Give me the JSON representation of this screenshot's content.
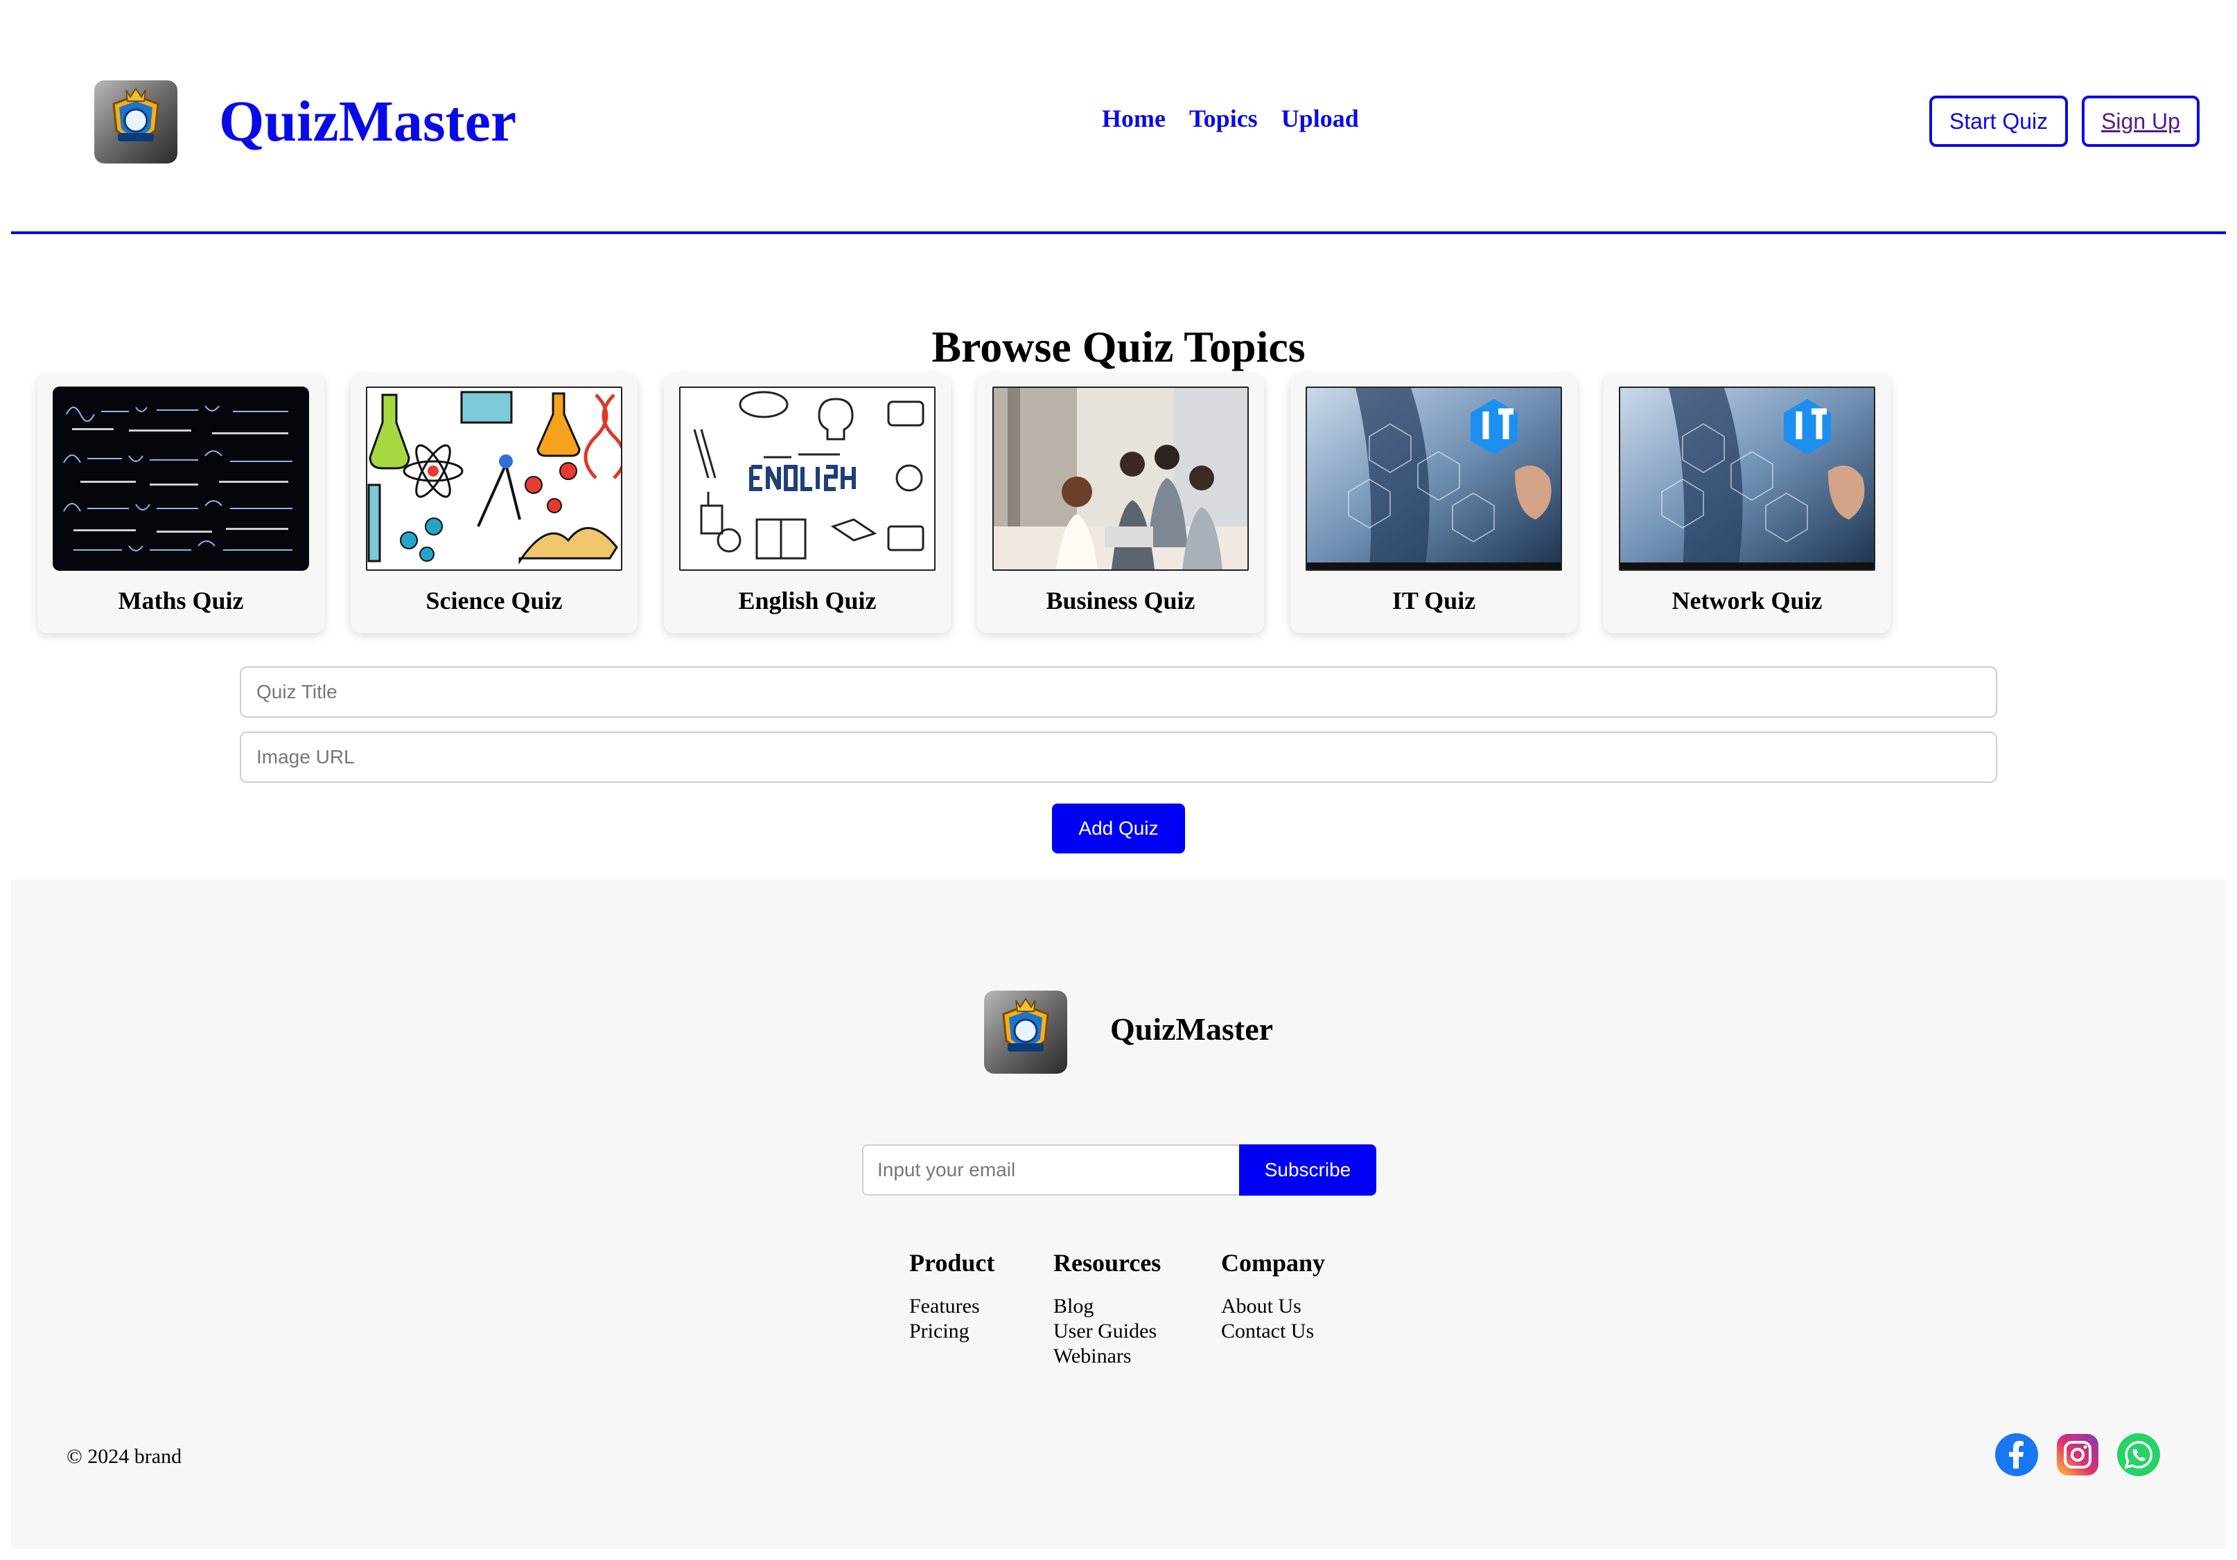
{
  "header": {
    "brand": "QuizMaster",
    "logo_icon": "quiz-master-logo",
    "nav": [
      {
        "label": "Home"
      },
      {
        "label": "Topics"
      },
      {
        "label": "Upload"
      }
    ],
    "start_quiz_label": "Start Quiz",
    "sign_up_label": "Sign Up"
  },
  "main": {
    "title": "Browse Quiz Topics",
    "topics": [
      {
        "label": "Maths Quiz"
      },
      {
        "label": "Science Quiz"
      },
      {
        "label": "English Quiz"
      },
      {
        "label": "Business Quiz"
      },
      {
        "label": "IT Quiz"
      },
      {
        "label": "Network Quiz"
      }
    ],
    "quiz_title_placeholder": "Quiz Title",
    "image_url_placeholder": "Image URL",
    "add_quiz_label": "Add Quiz"
  },
  "footer": {
    "brand": "QuizMaster",
    "email_placeholder": "Input your email",
    "subscribe_label": "Subscribe",
    "columns": [
      {
        "heading": "Product",
        "links": [
          "Features",
          "Pricing"
        ]
      },
      {
        "heading": "Resources",
        "links": [
          "Blog",
          "User Guides",
          "Webinars"
        ]
      },
      {
        "heading": "Company",
        "links": [
          "About Us",
          "Contact Us"
        ]
      }
    ],
    "copyright": "© 2024 brand",
    "social_icons": [
      "facebook-icon",
      "instagram-icon",
      "whatsapp-icon"
    ]
  },
  "colors": {
    "accent": "#0a0ae6",
    "button": "#0000f5",
    "footer_bg": "#f7f7f7"
  }
}
